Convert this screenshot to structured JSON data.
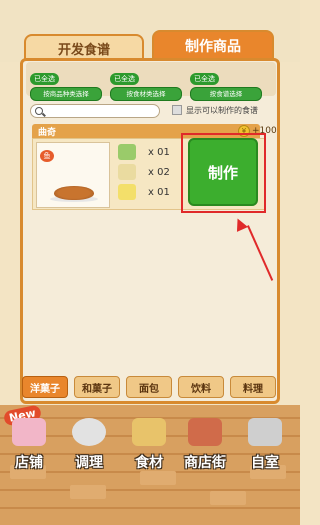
{
  "tabs": {
    "develop_recipe": "开发食谱",
    "make_product": "制作商品"
  },
  "filters": [
    {
      "badge": "已全选",
      "label": "按商品种类选择"
    },
    {
      "badge": "已全选",
      "label": "按食材类选择"
    },
    {
      "badge": "已全选",
      "label": "按食谱选择"
    }
  ],
  "search": {
    "placeholder": ""
  },
  "show_makeable": {
    "label": "显示可以制作的食谱",
    "checked": false
  },
  "recipe": {
    "name": "曲奇",
    "price": "+100",
    "fish_badge": "鱼",
    "ingredients": [
      {
        "icon": "herb-icon",
        "qty": "x 01"
      },
      {
        "icon": "flour-icon",
        "qty": "x 02"
      },
      {
        "icon": "butter-icon",
        "qty": "x 01"
      }
    ],
    "make_label": "制作"
  },
  "categories": [
    {
      "label": "洋菓子",
      "active": true
    },
    {
      "label": "和菓子",
      "active": false
    },
    {
      "label": "面包",
      "active": false
    },
    {
      "label": "饮料",
      "active": false
    },
    {
      "label": "料理",
      "active": false
    }
  ],
  "nav": [
    {
      "label": "店铺",
      "icon": "cake-icon"
    },
    {
      "label": "调理",
      "icon": "cooking-pot-icon"
    },
    {
      "label": "食材",
      "icon": "flour-sack-icon"
    },
    {
      "label": "商店街",
      "icon": "shop-icon"
    },
    {
      "label": "自室",
      "icon": "room-sign-icon"
    }
  ],
  "new_badge": "New",
  "colors": {
    "accent": "#e9862c",
    "make_button": "#3cae2e",
    "highlight": "#e02a2a"
  }
}
